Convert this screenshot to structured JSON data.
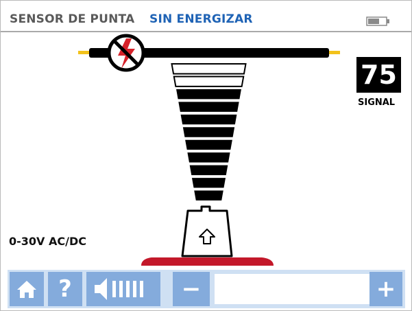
{
  "header": {
    "mode_label": "SENSOR DE PUNTA",
    "status_label": "SIN ENERGIZAR",
    "battery_icon": "battery-icon"
  },
  "signal": {
    "value": "75",
    "label": "SIGNAL"
  },
  "range_label": "0-30V AC/DC",
  "indicator": {
    "outlined_bars": 2,
    "filled_bars": 9
  },
  "toolbar": {
    "home_icon": "home-icon",
    "help_label": "?",
    "volume_icon": "speaker-icon",
    "minus_label": "−",
    "plus_label": "+"
  },
  "colors": {
    "status": "#1f63b5",
    "toolbar_button": "#84abdc",
    "toolbar_bg": "#cfe0f3",
    "wire_tip": "#f2c21b",
    "base_red": "#c3182a",
    "icon_red": "#d6222a"
  }
}
